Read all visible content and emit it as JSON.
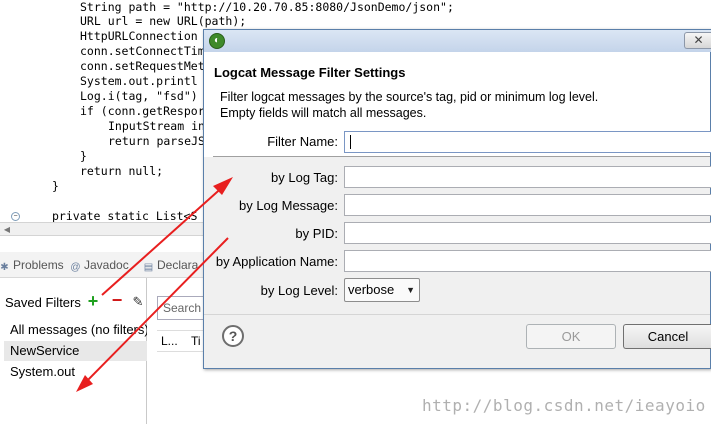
{
  "editor": {
    "lines": [
      {
        "indent": "        ",
        "text": "String path = \"http://10.20.70.85:8080/JsonDemo/json\";"
      },
      {
        "indent": "        ",
        "text": "URL url = new URL(path);"
      },
      {
        "indent": "        ",
        "text": "HttpURLConnection"
      },
      {
        "indent": "        ",
        "text": "conn.setConnectTim"
      },
      {
        "indent": "        ",
        "text": "conn.setRequestMet"
      },
      {
        "indent": "        ",
        "text": "System.out.printl"
      },
      {
        "indent": "        ",
        "text": "Log.i(tag, \"fsd\")"
      },
      {
        "indent": "        ",
        "text": "if (conn.getRespor"
      },
      {
        "indent": "            ",
        "text": "InputStream in"
      },
      {
        "indent": "            ",
        "text": "return parseJS"
      },
      {
        "indent": "        ",
        "text": "}"
      },
      {
        "indent": "        ",
        "text": "return null;"
      },
      {
        "indent": "    ",
        "text": "}"
      },
      {
        "indent": "",
        "text": ""
      },
      {
        "indent": "    ",
        "text": "private static List<S"
      }
    ],
    "fold_marker": "−"
  },
  "view_tabs": [
    {
      "label": "Problems",
      "icon": "problems-icon",
      "glyph": "✱"
    },
    {
      "label": "Javadoc",
      "icon": "javadoc-icon",
      "glyph": "@"
    },
    {
      "label": "Declara",
      "icon": "declaration-icon",
      "glyph": "▤"
    }
  ],
  "saved_filters": {
    "title": "Saved Filters",
    "add_glyph": "+",
    "remove_glyph": "−",
    "edit_glyph": "✎",
    "items": [
      "All messages (no filters)",
      "NewService",
      "System.out"
    ],
    "selected_index": 1
  },
  "logcat": {
    "search_placeholder": "Search",
    "col_level": "L...",
    "col_time": "Ti"
  },
  "dialog": {
    "app_icon_glyph": "◐",
    "close_glyph": "✕",
    "title": "Logcat Message Filter Settings",
    "description_line1": "Filter logcat messages by the source's tag, pid or minimum log level.",
    "description_line2": "Empty fields will match all messages.",
    "filter_name_label": "Filter Name:",
    "filter_name_value": "",
    "log_tag_label": "by Log Tag:",
    "log_tag_value": "",
    "log_message_label": "by Log Message:",
    "log_message_value": "",
    "pid_label": "by PID:",
    "pid_value": "",
    "application_name_label": "by Application Name:",
    "application_name_value": "",
    "log_level_label": "by Log Level:",
    "log_level_value": "verbose",
    "help_glyph": "?",
    "ok_label": "OK",
    "cancel_label": "Cancel"
  },
  "watermark": "http://blog.csdn.net/ieayoio",
  "colors": {
    "annotation_arrow": "#e81f1f",
    "dialog_border": "#5a7faa",
    "selected_row": "#e8e8e8",
    "add_icon": "#20a020",
    "remove_icon": "#d01818"
  }
}
